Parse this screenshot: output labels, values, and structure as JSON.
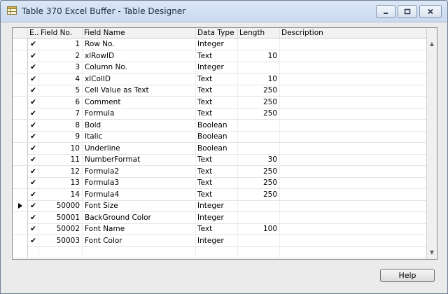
{
  "window": {
    "title": "Table 370 Excel Buffer - Table Designer"
  },
  "columns": {
    "enabled": "E..",
    "field_no": "Field No.",
    "field_name": "Field Name",
    "data_type": "Data Type",
    "length": "Length",
    "description": "Description"
  },
  "rows": [
    {
      "enabled": "✔",
      "field_no": "1",
      "field_name": "Row No.",
      "data_type": "Integer",
      "length": "",
      "selected": false
    },
    {
      "enabled": "✔",
      "field_no": "2",
      "field_name": "xlRowID",
      "data_type": "Text",
      "length": "10",
      "selected": false
    },
    {
      "enabled": "✔",
      "field_no": "3",
      "field_name": "Column No.",
      "data_type": "Integer",
      "length": "",
      "selected": false
    },
    {
      "enabled": "✔",
      "field_no": "4",
      "field_name": "xlColID",
      "data_type": "Text",
      "length": "10",
      "selected": false
    },
    {
      "enabled": "✔",
      "field_no": "5",
      "field_name": "Cell Value as Text",
      "data_type": "Text",
      "length": "250",
      "selected": false
    },
    {
      "enabled": "✔",
      "field_no": "6",
      "field_name": "Comment",
      "data_type": "Text",
      "length": "250",
      "selected": false
    },
    {
      "enabled": "✔",
      "field_no": "7",
      "field_name": "Formula",
      "data_type": "Text",
      "length": "250",
      "selected": false
    },
    {
      "enabled": "✔",
      "field_no": "8",
      "field_name": "Bold",
      "data_type": "Boolean",
      "length": "",
      "selected": false
    },
    {
      "enabled": "✔",
      "field_no": "9",
      "field_name": "Italic",
      "data_type": "Boolean",
      "length": "",
      "selected": false
    },
    {
      "enabled": "✔",
      "field_no": "10",
      "field_name": "Underline",
      "data_type": "Boolean",
      "length": "",
      "selected": false
    },
    {
      "enabled": "✔",
      "field_no": "11",
      "field_name": "NumberFormat",
      "data_type": "Text",
      "length": "30",
      "selected": false
    },
    {
      "enabled": "✔",
      "field_no": "12",
      "field_name": "Formula2",
      "data_type": "Text",
      "length": "250",
      "selected": false
    },
    {
      "enabled": "✔",
      "field_no": "13",
      "field_name": "Formula3",
      "data_type": "Text",
      "length": "250",
      "selected": false
    },
    {
      "enabled": "✔",
      "field_no": "14",
      "field_name": "Formula4",
      "data_type": "Text",
      "length": "250",
      "selected": false
    },
    {
      "enabled": "✔",
      "field_no": "50000",
      "field_name": "Font Size",
      "data_type": "Integer",
      "length": "",
      "selected": true
    },
    {
      "enabled": "✔",
      "field_no": "50001",
      "field_name": "BackGround Color",
      "data_type": "Integer",
      "length": "",
      "selected": false
    },
    {
      "enabled": "✔",
      "field_no": "50002",
      "field_name": "Font Name",
      "data_type": "Text",
      "length": "100",
      "selected": false
    },
    {
      "enabled": "✔",
      "field_no": "50003",
      "field_name": "Font Color",
      "data_type": "Integer",
      "length": "",
      "selected": false
    },
    {
      "enabled": "",
      "field_no": "",
      "field_name": "",
      "data_type": "",
      "length": "",
      "selected": false
    }
  ],
  "buttons": {
    "help": "Help"
  },
  "icons": {
    "window": "table-designer-icon",
    "selector": "row-selector-arrow-icon",
    "scroll_up": "scroll-up-icon",
    "scroll_down": "scroll-down-icon"
  },
  "colors": {
    "titlebar": "#c9d9ef",
    "window_bg": "#ebebeb",
    "grid_bg": "#ffffff"
  }
}
